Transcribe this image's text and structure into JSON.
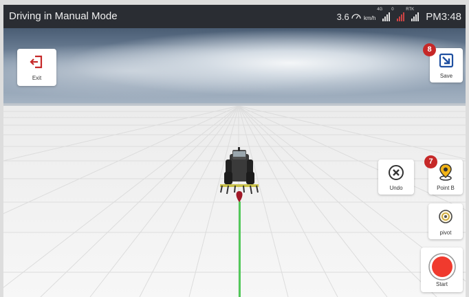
{
  "statusbar": {
    "title": "Driving in Manual Mode",
    "speed_value": "3.6",
    "speed_unit": "km/h",
    "network_label": "4G",
    "rtk_label": "RTK",
    "sat_count": "0",
    "time": "PM3:48"
  },
  "buttons": {
    "exit": "Exit",
    "save": "Save",
    "undo": "Undo",
    "point_b": "Point B",
    "pivot": "pivot",
    "start": "Start"
  },
  "badges": {
    "save": "8",
    "point_b": "7"
  },
  "colors": {
    "statusbar_bg": "#2a2d33",
    "badge": "#c62828",
    "start_red": "#f03a2e",
    "guideline_green": "#53c85a",
    "exit_icon": "#c62828",
    "save_icon": "#1e4fa0",
    "point_b_icon": "#f2b417"
  },
  "icons": {
    "exit": "exit-icon",
    "save": "save-icon",
    "undo": "undo-icon",
    "point_b": "location-pin-icon",
    "pivot": "pivot-target-icon",
    "start": "record-icon",
    "speed": "speedometer-icon",
    "network": "signal-bars-icon",
    "satellite": "satellite-signal-icon",
    "rtk": "rtk-signal-icon"
  }
}
